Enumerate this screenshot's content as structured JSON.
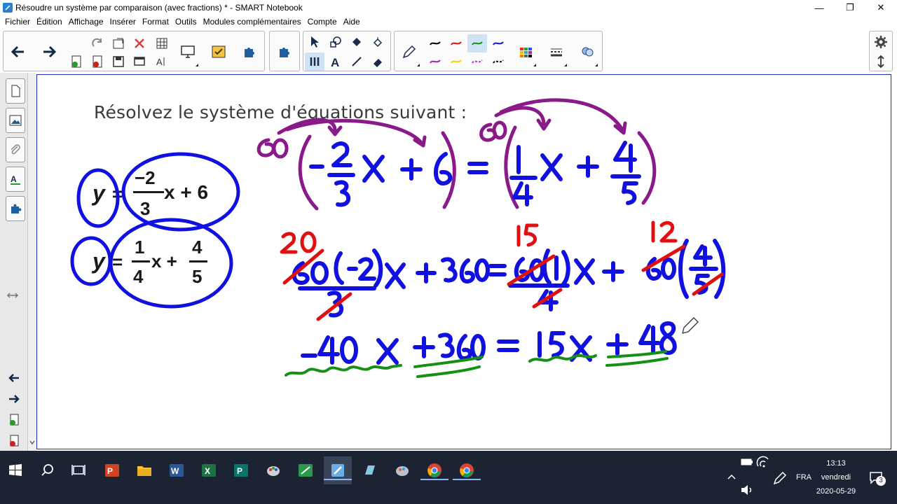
{
  "window": {
    "title": "Résoudre un système par comparaison (avec fractions) * - SMART Notebook",
    "controls": [
      "—",
      "❐",
      "✕"
    ]
  },
  "menu": [
    "Fichier",
    "Édition",
    "Affichage",
    "Insérer",
    "Format",
    "Outils",
    "Modules complémentaires",
    "Compte",
    "Aide"
  ],
  "canvas": {
    "prompt": "Résolvez le système d'équations suivant :",
    "system": {
      "eq1": {
        "lhs": "y",
        "sign": "=",
        "num": "−2",
        "den": "3",
        "rest": "x + 6"
      },
      "eq2": {
        "lhs": "y",
        "sign": "=",
        "num1": "1",
        "den1": "4",
        "mid": "x +",
        "num2": "4",
        "den2": "5"
      }
    }
  },
  "colors": {
    "ink_blue": "#1010e0",
    "ink_purple": "#8a1a8a",
    "ink_red": "#e01010",
    "ink_green": "#149014",
    "taskbar": "#1c2332"
  },
  "taskbar": {
    "apps": [
      "start-icon",
      "search-icon",
      "task-view-icon",
      "powerpoint-icon",
      "file-explorer-icon",
      "word-icon",
      "excel-icon",
      "publisher-icon",
      "paint-icon",
      "geogebra-icon",
      "smart-notebook-icon",
      "notebook-tool-icon",
      "paint3d-icon",
      "chrome-icon",
      "chrome-icon-2"
    ],
    "lang": "FRA",
    "time": "13:13",
    "day": "vendredi",
    "date": "2020-05-29",
    "notifications": "3"
  }
}
